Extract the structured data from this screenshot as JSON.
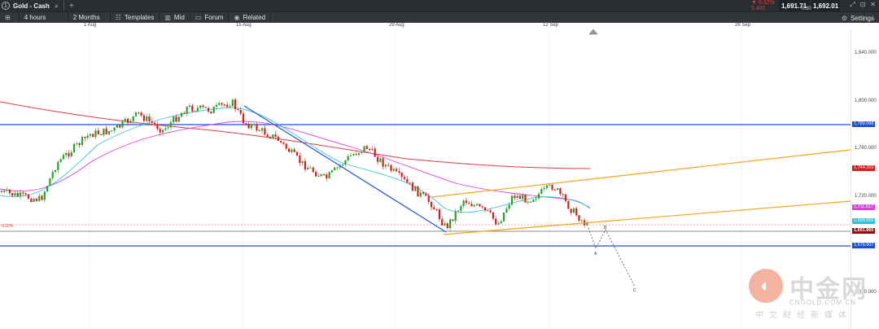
{
  "window": {
    "title": "Gold - Cash",
    "change_pct": "▼ 0.32%",
    "change_abs": "5.495",
    "bid": "1,691.71",
    "ask": "1,692.01",
    "spread": "0.30"
  },
  "toolbar": {
    "timeframe": "4 hours",
    "range": "2 Months",
    "templates": "Templates",
    "mid": "Mid",
    "forum": "Forum",
    "related": "Related",
    "settings": "Settings"
  },
  "chart": {
    "date_labels": [
      "1 Aug",
      "15 Aug",
      "29 Aug",
      "12 Sep",
      "26 Sep"
    ],
    "price_ticks": [
      "1,840.000",
      "1,800.000",
      "1,760.000",
      "1,720.000",
      "1,680.000"
    ],
    "pct_label": "0.32%",
    "tags": {
      "upper_blue": "1,780.068",
      "red_ma": "1,744.203",
      "magenta_ma": "1,711.817",
      "cyan_ma": "1,699.555",
      "last_price": "1,691.860",
      "lower_blue": "1,678.907"
    },
    "wave_labels": [
      "A",
      "B",
      "C"
    ],
    "colors": {
      "candle_up": "#27a327",
      "candle_down": "#d81b1b",
      "red_ma": "#e03c3c",
      "magenta_ma": "#e040e0",
      "cyan_ma": "#43c4d4",
      "channel": "#f7a21b",
      "trendline": "#2a5bd7",
      "level": "#1a4fd6"
    }
  },
  "watermark": {
    "logo_glyph": "◐",
    "name_cn": "中金网",
    "url": "CNGOLD.COM.CN",
    "tagline": "中文财经新媒体"
  }
}
